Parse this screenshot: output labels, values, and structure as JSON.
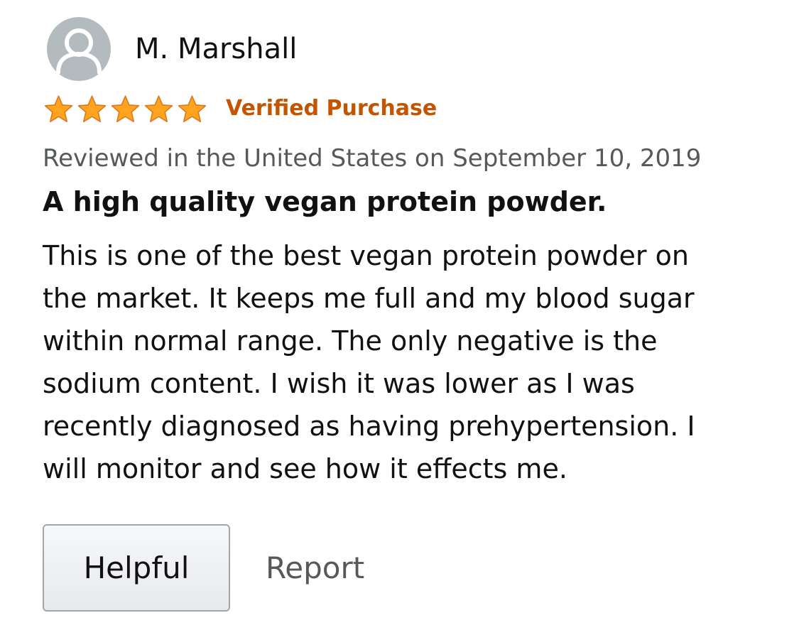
{
  "reviewer": {
    "name": "M. Marshall",
    "avatar_icon": "user-silhouette-icon"
  },
  "rating": {
    "stars": 5,
    "max": 5,
    "star_color": "#ffa41c"
  },
  "badge": {
    "verified_label": "Verified Purchase",
    "color": "#c45500"
  },
  "review": {
    "date_line": "Reviewed in the United States on September 10, 2019",
    "title": "A high quality vegan protein powder.",
    "body_lines": [
      "This is one of the best vegan protein powder on",
      "the market. It keeps me full and my blood sugar",
      "within normal range. The only negative is the",
      "sodium content. I wish it was lower as I was",
      "recently diagnosed as having prehypertension. I",
      "will monitor and see how it effects me."
    ]
  },
  "actions": {
    "helpful_label": "Helpful",
    "report_label": "Report"
  }
}
